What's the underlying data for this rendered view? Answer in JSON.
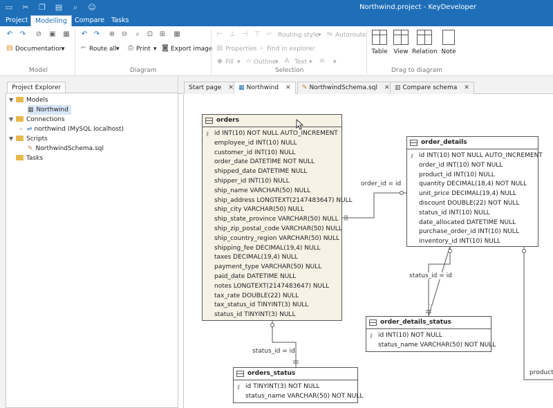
{
  "window": {
    "title": "Northwind.project - KeyDeveloper"
  },
  "menu": [
    "Project",
    "Modelling",
    "Compare",
    "Tasks"
  ],
  "ribbon": {
    "groups": {
      "model": "Model",
      "diagram": "Diagram",
      "selection": "Selection",
      "drag": "Drag  to diagram"
    },
    "documentation": "Documentation",
    "route_all": "Route all",
    "print": "Print",
    "export_image": "Export image",
    "routing_style": "Routing style",
    "autoroute": "Autoroute",
    "properties": "Properties",
    "find_in_explorer": "Find in explorer",
    "fill": "Fill",
    "outline": "Outline",
    "text": "Text",
    "big_buttons": [
      "Table",
      "View",
      "Relation",
      "Note"
    ]
  },
  "explorer": {
    "tab": "Project Explorer",
    "tree": {
      "models": "Models",
      "northwind": "Northwind",
      "connections": "Connections",
      "connection_item": "northwind (MySQL localhost)",
      "scripts": "Scripts",
      "script_item": "NorthwindSchema.sql",
      "tasks": "Tasks"
    }
  },
  "tabs": [
    "Start page",
    "Northwind",
    "NorthwindSchema.sql",
    "Compare schema"
  ],
  "diagram": {
    "relations": [
      "order_id = id",
      "status_id = id",
      "status_id = id",
      "product_"
    ],
    "orders": {
      "name": "orders",
      "columns": [
        "id INT(10)  NOT NULL  AUTO_INCREMENT",
        "employee_id INT(10)  NULL",
        "customer_id INT(10)  NULL",
        "order_date DATETIME NOT NULL",
        "shipped_date DATETIME NULL",
        "shipper_id INT(10)  NULL",
        "ship_name VARCHAR(50)  NULL",
        "ship_address LONGTEXT(2147483647)  NULL",
        "ship_city VARCHAR(50)  NULL",
        "ship_state_province VARCHAR(50)  NULL",
        "ship_zip_postal_code VARCHAR(50)  NULL",
        "ship_country_region VARCHAR(50)  NULL",
        "shipping_fee DECIMAL(19,4)  NULL",
        "taxes DECIMAL(19,4)  NULL",
        "payment_type VARCHAR(50)  NULL",
        "paid_date DATETIME NULL",
        "notes LONGTEXT(2147483647)  NULL",
        "tax_rate DOUBLE(22)  NULL",
        "tax_status_id TINYINT(3)  NULL",
        "status_id TINYINT(3)  NULL"
      ]
    },
    "order_details": {
      "name": "order_details",
      "columns": [
        "id INT(10)  NOT NULL  AUTO_INCREMENT",
        "order_id INT(10)  NOT NULL",
        "product_id INT(10)  NULL",
        "quantity DECIMAL(18,4)  NOT NULL",
        "unit_price DECIMAL(19,4)  NULL",
        "discount DOUBLE(22)  NOT NULL",
        "status_id INT(10)  NULL",
        "date_allocated DATETIME NULL",
        "purchase_order_id INT(10)  NULL",
        "inventory_id INT(10)  NULL"
      ]
    },
    "order_details_status": {
      "name": "order_details_status",
      "columns": [
        "id INT(10)  NOT NULL",
        "status_name VARCHAR(50)  NOT NULL"
      ]
    },
    "orders_status": {
      "name": "orders_status",
      "columns": [
        "id TINYINT(3)  NOT NULL",
        "status_name VARCHAR(50)  NOT NULL"
      ]
    }
  }
}
